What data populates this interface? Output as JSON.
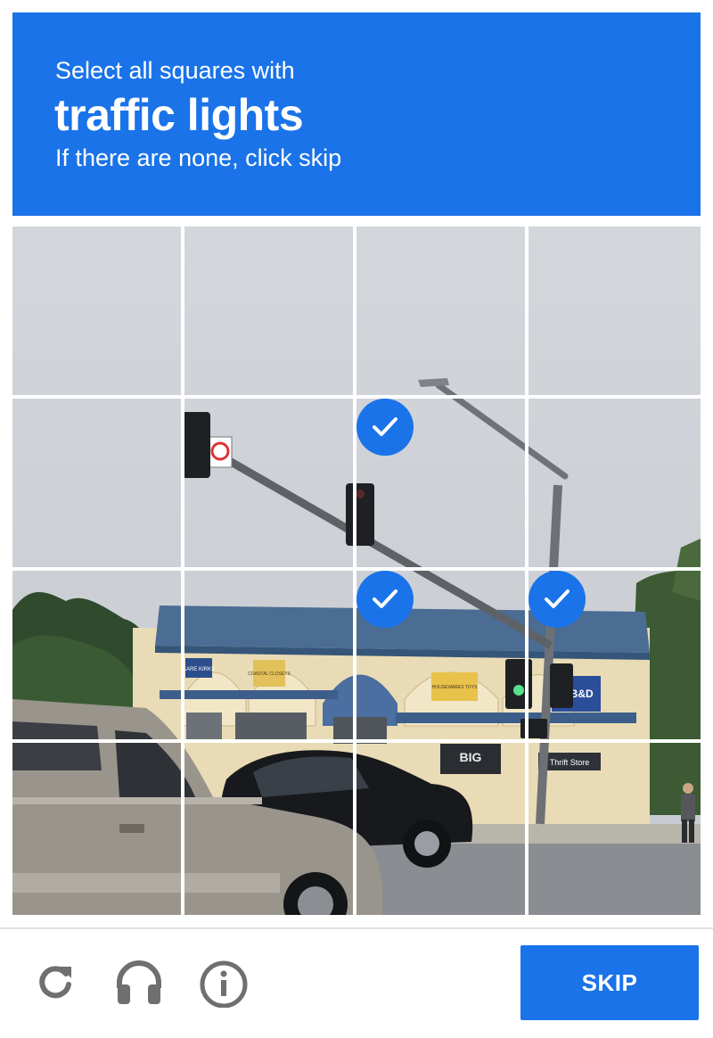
{
  "challenge": {
    "instruction": "Select all squares with",
    "target": "traffic lights",
    "hint": "If there are none, click skip"
  },
  "grid": {
    "rows": 4,
    "cols": 4,
    "selected": [
      [
        1,
        2
      ],
      [
        2,
        2
      ],
      [
        2,
        3
      ]
    ]
  },
  "store_signs": {
    "sign1": "KARE KIRKS",
    "sign2": "COASTAL CLOSETS",
    "sign3": "HOUSEWARES TOYS",
    "sign4": "BIG",
    "sign5": "Thrift Store",
    "sign6": "3, B&D"
  },
  "footer": {
    "reload_icon": "reload-icon",
    "audio_icon": "headphones-icon",
    "info_icon": "info-icon",
    "skip_label": "SKIP"
  },
  "colors": {
    "brand": "#1a73e8",
    "check": "#1a73e8"
  }
}
